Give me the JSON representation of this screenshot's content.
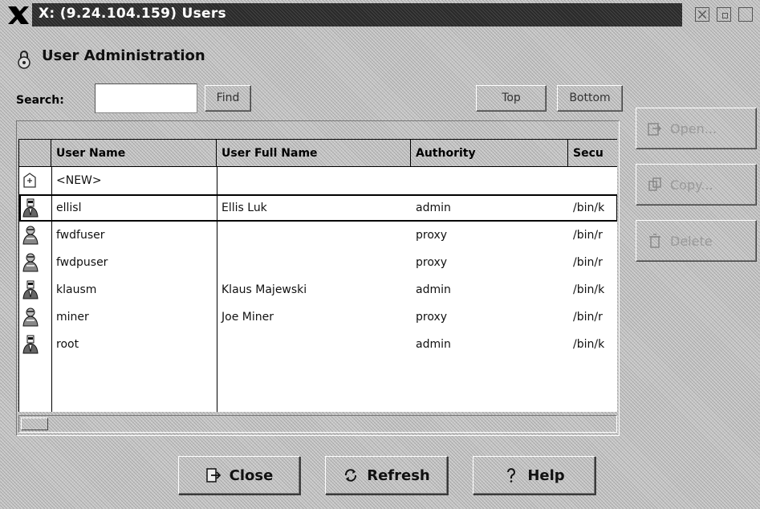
{
  "window": {
    "title": "X: (9.24.104.159) Users"
  },
  "header": {
    "title": "User Administration"
  },
  "search": {
    "label": "Search:",
    "value": "",
    "find_label": "Find",
    "top_label": "Top",
    "bottom_label": "Bottom"
  },
  "table": {
    "columns": [
      "User Name",
      "User Full Name",
      "Authority",
      "Secu"
    ],
    "rows": [
      {
        "icon": "new-user-icon",
        "user": "<NEW>",
        "full_name": "",
        "authority": "",
        "security": ""
      },
      {
        "icon": "admin-user-icon",
        "user": "ellisl",
        "full_name": "Ellis Luk",
        "authority": "admin",
        "security": "/bin/k"
      },
      {
        "icon": "proxy-user-icon",
        "user": "fwdfuser",
        "full_name": "",
        "authority": "proxy",
        "security": "/bin/r"
      },
      {
        "icon": "proxy-user-icon",
        "user": "fwdpuser",
        "full_name": "",
        "authority": "proxy",
        "security": "/bin/r"
      },
      {
        "icon": "admin-user-icon",
        "user": "klausm",
        "full_name": "Klaus Majewski",
        "authority": "admin",
        "security": "/bin/k"
      },
      {
        "icon": "proxy-user-icon",
        "user": "miner",
        "full_name": "Joe Miner",
        "authority": "proxy",
        "security": "/bin/r"
      },
      {
        "icon": "admin-user-icon",
        "user": "root",
        "full_name": "",
        "authority": "admin",
        "security": "/bin/k"
      }
    ]
  },
  "side_actions": {
    "open_label": "Open...",
    "copy_label": "Copy...",
    "delete_label": "Delete"
  },
  "footer": {
    "close_label": "Close",
    "refresh_label": "Refresh",
    "help_label": "Help"
  }
}
